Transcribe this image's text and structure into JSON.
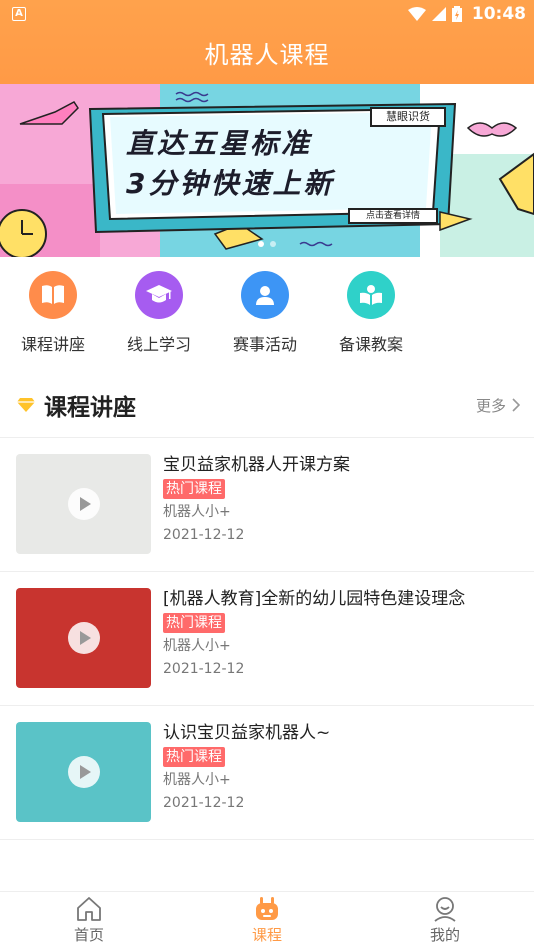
{
  "statusbar": {
    "time": "10:48",
    "badge": "A"
  },
  "header": {
    "title": "机器人课程"
  },
  "banner": {
    "line1": "直达五星标准",
    "line2": "3分钟快速上新",
    "tag": "慧眼识货",
    "cta": "点击查看详情"
  },
  "quick_links": [
    {
      "label": "课程讲座",
      "icon": "book-icon",
      "color": "#ff8c4b"
    },
    {
      "label": "线上学习",
      "icon": "graduation-cap-icon",
      "color": "#a65cf0"
    },
    {
      "label": "赛事活动",
      "icon": "user-icon",
      "color": "#3d95f5"
    },
    {
      "label": "备课教案",
      "icon": "reader-icon",
      "color": "#2fd1c9"
    }
  ],
  "section": {
    "title": "课程讲座",
    "more": "更多"
  },
  "courses": [
    {
      "title": "宝贝益家机器人开课方案",
      "tag": "热门课程",
      "author": "机器人小+",
      "date": "2021-12-12",
      "thumb_bg": "#e8e9e7"
    },
    {
      "title": "[机器人教育]全新的幼儿园特色建设理念",
      "tag": "热门课程",
      "author": "机器人小+",
      "date": "2021-12-12",
      "thumb_bg": "#c8342f"
    },
    {
      "title": "认识宝贝益家机器人~",
      "tag": "热门课程",
      "author": "机器人小+",
      "date": "2021-12-12",
      "thumb_bg": "#5ac3c7"
    }
  ],
  "tabs": [
    {
      "label": "首页",
      "icon": "home-icon"
    },
    {
      "label": "课程",
      "icon": "robot-icon"
    },
    {
      "label": "我的",
      "icon": "profile-icon"
    }
  ]
}
